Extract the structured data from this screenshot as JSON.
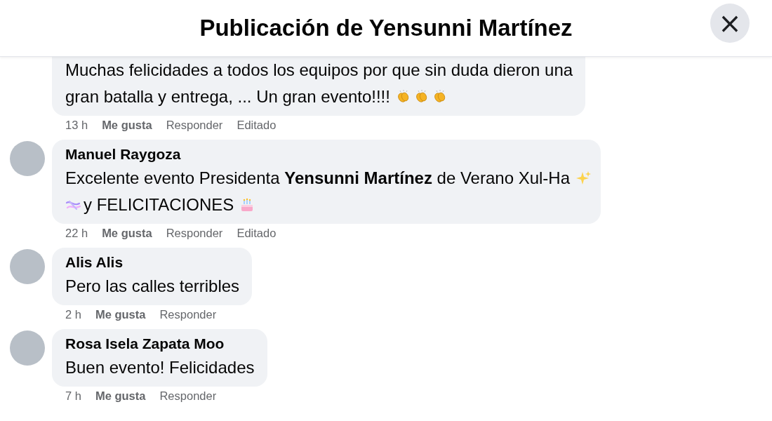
{
  "header": {
    "title": "Publicación de Yensunni Martínez",
    "close": "×"
  },
  "comments": [
    {
      "lines": [
        [
          {
            "kind": "text",
            "text": "Muchas felicidades a todos los equipos por que sin duda dieron una"
          }
        ],
        [
          {
            "kind": "text",
            "text": "gran batalla y entrega, ... Un gran evento!!!!"
          },
          {
            "kind": "clap"
          },
          {
            "kind": "clap"
          },
          {
            "kind": "clap"
          }
        ]
      ],
      "actions": {
        "time": "13 h",
        "like": "Me gusta",
        "reply": "Responder",
        "edited": "Editado"
      }
    },
    {
      "author": "Manuel Raygoza",
      "lines": [
        [
          {
            "kind": "text",
            "text": "Excelente evento Presidenta **Yensunni Martínez** de Verano Xul-Ha"
          },
          {
            "kind": "sparkles"
          }
        ],
        [
          {
            "kind": "ribbon"
          },
          {
            "kind": "text",
            "text": "y FELICITACIONES"
          },
          {
            "kind": "cake"
          }
        ]
      ],
      "actions": {
        "time": "22 h",
        "like": "Me gusta",
        "reply": "Responder",
        "edited": "Editado"
      }
    },
    {
      "author": "Alis Alis",
      "lines": [
        [
          {
            "kind": "text",
            "text": "Pero las calles terribles"
          }
        ]
      ],
      "actions": {
        "time": "2 h",
        "like": "Me gusta",
        "reply": "Responder"
      }
    },
    {
      "author": "Rosa Isela Zapata Moo",
      "lines": [
        [
          {
            "kind": "text",
            "text": "Buen evento! Felicidades"
          }
        ]
      ],
      "actions": {
        "time": "7 h",
        "like": "Me gusta",
        "reply": "Responder"
      }
    }
  ]
}
